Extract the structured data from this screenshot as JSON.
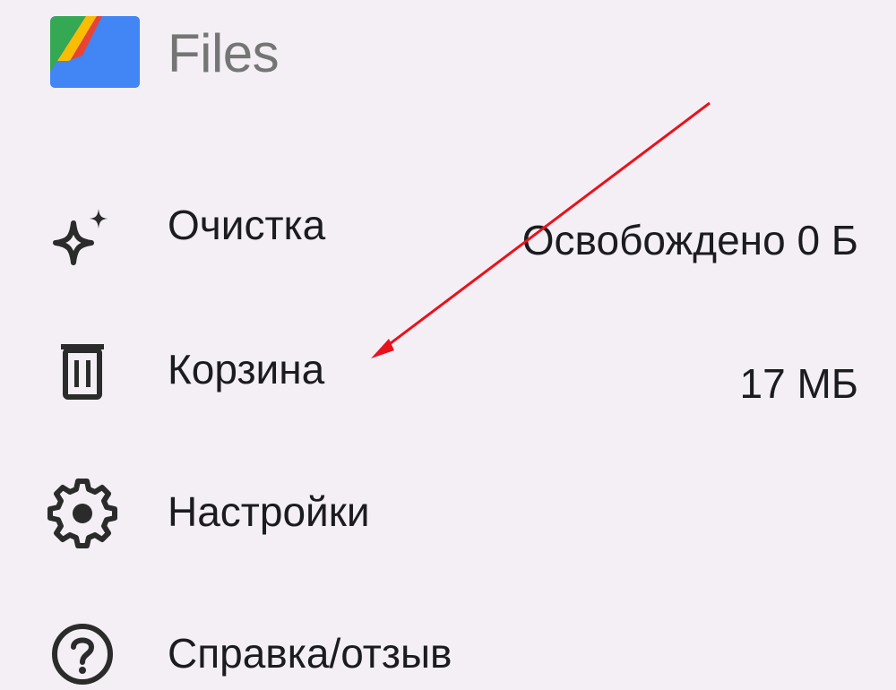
{
  "app": {
    "title": "Files",
    "logo_icon": "files-logo-icon"
  },
  "menu": {
    "items": [
      {
        "key": "cleanup",
        "label": "Очистка",
        "value": "Освобождено 0 Б",
        "icon": "sparkle-icon"
      },
      {
        "key": "trash",
        "label": "Корзина",
        "value": "17 МБ",
        "icon": "trash-icon"
      },
      {
        "key": "settings",
        "label": "Настройки",
        "value": "",
        "icon": "gear-icon"
      },
      {
        "key": "help",
        "label": "Справка/отзыв",
        "value": "",
        "icon": "help-icon"
      }
    ]
  },
  "annotation": {
    "type": "arrow",
    "color": "#e8121c",
    "points_to": "Корзина"
  },
  "colors": {
    "background": "#f3eff5",
    "text": "#1c1b1f",
    "title": "#757575",
    "logo_blue": "#4285f4",
    "logo_green": "#34a853",
    "logo_yellow": "#fbbc04",
    "logo_red": "#ea4335"
  }
}
